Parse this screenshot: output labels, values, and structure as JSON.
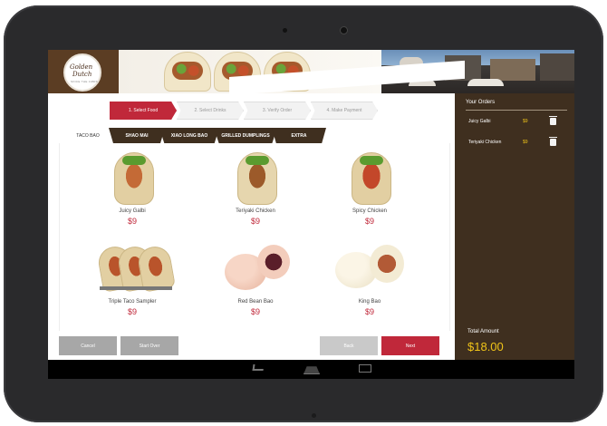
{
  "brand": {
    "logo_line1": "Golden",
    "logo_line2": "Dutch",
    "logo_tagline": "SINCE THE 1980S"
  },
  "steps": [
    {
      "label": "1. Select Food",
      "active": true
    },
    {
      "label": "2. Select Drinks",
      "active": false
    },
    {
      "label": "3. Verify Order",
      "active": false
    },
    {
      "label": "4. Make Payment",
      "active": false
    }
  ],
  "tabs": [
    {
      "label": "TACO BAO",
      "active": true
    },
    {
      "label": "SHAO MAI",
      "active": false
    },
    {
      "label": "XIAO LONG BAO",
      "active": false
    },
    {
      "label": "GRILLED DUMPLINGS",
      "active": false
    },
    {
      "label": "EXTRA",
      "active": false
    }
  ],
  "items": [
    {
      "name": "Juicy Galbi",
      "price": "$9",
      "image": "taco-galbi"
    },
    {
      "name": "Teriyaki Chicken",
      "price": "$9",
      "image": "taco-teriyaki"
    },
    {
      "name": "Spicy Chicken",
      "price": "$9",
      "image": "taco-spicy"
    },
    {
      "name": "Triple Taco Sampler",
      "price": "$9",
      "image": "taco-sampler"
    },
    {
      "name": "Red Bean Bao",
      "price": "$9",
      "image": "red-bean-bao"
    },
    {
      "name": "King Bao",
      "price": "$9",
      "image": "king-bao"
    }
  ],
  "buttons": {
    "cancel": "Cancel",
    "start_over": "Start Over",
    "back": "Back",
    "next": "Next"
  },
  "orders": {
    "title": "Your Orders",
    "rows": [
      {
        "name": "Juicy Galbi",
        "price": "$9"
      },
      {
        "name": "Teriyaki Chicken",
        "price": "$9"
      }
    ],
    "total_label": "Total Amount",
    "total": "$18.00"
  },
  "colors": {
    "accent": "#c0283a",
    "brown": "#3f2f1f",
    "gold": "#f0c419"
  },
  "icons": {
    "trash": "trash-icon",
    "back": "back-nav-icon",
    "home": "home-nav-icon",
    "recent": "recent-apps-icon"
  }
}
